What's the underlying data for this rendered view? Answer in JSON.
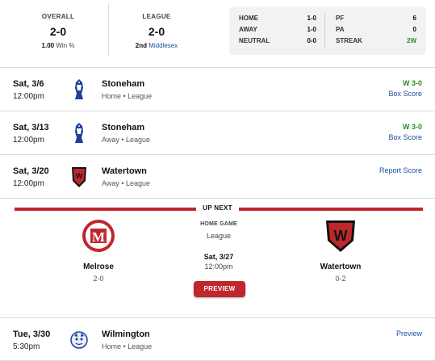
{
  "summary": {
    "overall": {
      "label": "OVERALL",
      "record": "2-0",
      "pct": "1.00",
      "pct_label": "Win %"
    },
    "league": {
      "label": "LEAGUE",
      "record": "2-0",
      "place": "2nd",
      "name": "Middlesex"
    },
    "splits": [
      {
        "label": "HOME",
        "value": "1-0"
      },
      {
        "label": "AWAY",
        "value": "1-0"
      },
      {
        "label": "NEUTRAL",
        "value": "0-0"
      }
    ],
    "points": [
      {
        "label": "PF",
        "value": "6"
      },
      {
        "label": "PA",
        "value": "0"
      },
      {
        "label": "STREAK",
        "value": "2W"
      }
    ]
  },
  "games": [
    {
      "date": "Sat, 3/6",
      "time": "12:00pm",
      "opponent": "Stoneham",
      "meta": "Home • League",
      "result": "W 3-0",
      "link": "Box Score",
      "logo": "stoneham-logo"
    },
    {
      "date": "Sat, 3/13",
      "time": "12:00pm",
      "opponent": "Stoneham",
      "meta": "Away • League",
      "result": "W 3-0",
      "link": "Box Score",
      "logo": "stoneham-logo"
    },
    {
      "date": "Sat, 3/20",
      "time": "12:00pm",
      "opponent": "Watertown",
      "meta": "Away • League",
      "result": "",
      "link": "Report Score",
      "logo": "watertown-logo"
    },
    {
      "date": "Tue, 3/30",
      "time": "5:30pm",
      "opponent": "Wilmington",
      "meta": "Home • League",
      "result": "",
      "link": "Preview",
      "logo": "wilmington-logo"
    }
  ],
  "up_next": {
    "label": "UP NEXT",
    "home_team": {
      "name": "Melrose",
      "record": "2-0",
      "logo_letter": "M"
    },
    "away_team": {
      "name": "Watertown",
      "record": "0-2",
      "logo_letter": "W"
    },
    "game_type": "HOME GAME",
    "league": "League",
    "date": "Sat, 3/27",
    "time": "12:00pm",
    "button": "PREVIEW"
  },
  "colors": {
    "accent": "#c0272d",
    "link": "#1a4f9e",
    "win": "#2a8a2a"
  }
}
